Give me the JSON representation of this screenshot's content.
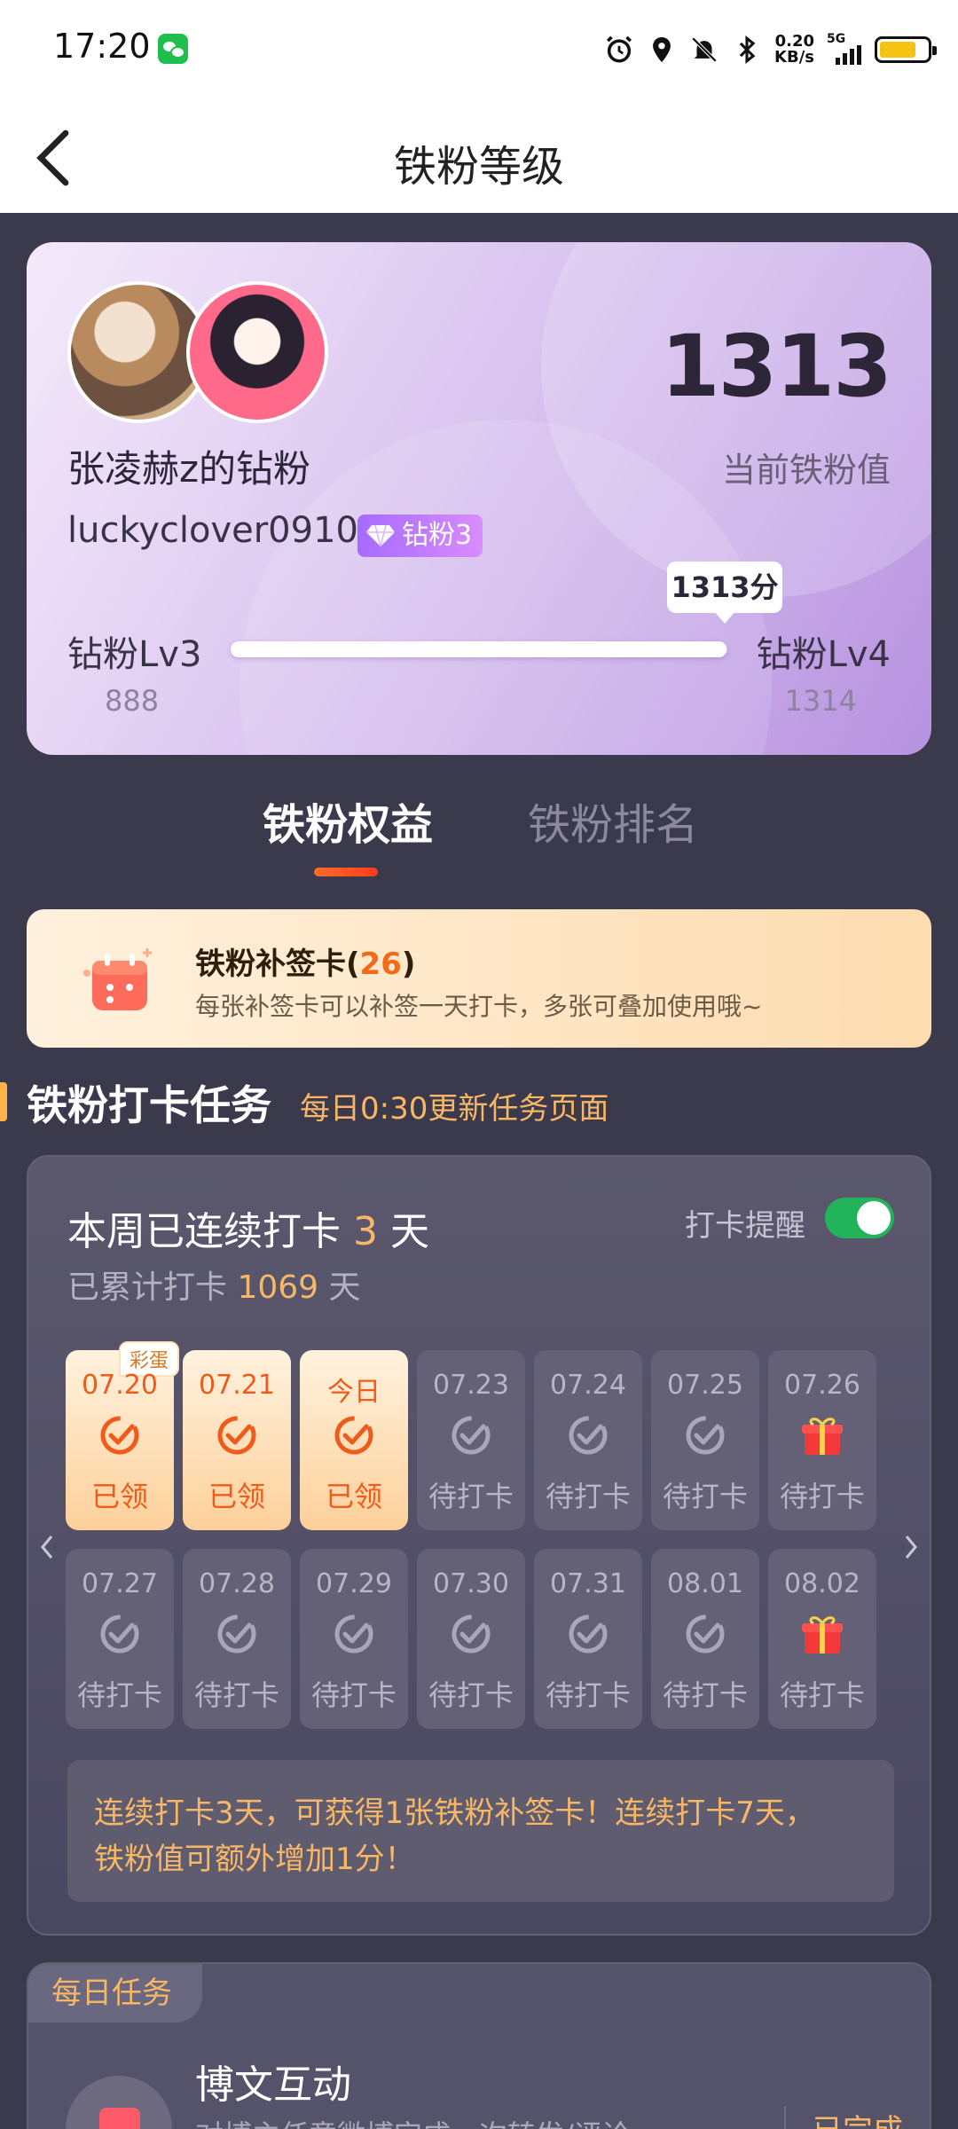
{
  "status_bar": {
    "time": "17:20",
    "net_speed": "0.20",
    "net_unit": "KB/s",
    "signal_label": "5G"
  },
  "nav": {
    "title": "铁粉等级"
  },
  "profile": {
    "fan_name": "张凌赫z的钻粉",
    "username": "luckyclover0910",
    "badge": "钻粉3",
    "fan_value": "1313",
    "fan_value_label": "当前铁粉值",
    "bubble": "1313分",
    "level_left": "钻粉Lv3",
    "level_right": "钻粉Lv4",
    "min_points": "888",
    "max_points": "1314",
    "progress_fraction": 0.998
  },
  "tabs": [
    {
      "label": "铁粉权益",
      "active": true
    },
    {
      "label": "铁粉排名",
      "active": false
    }
  ],
  "resign_card": {
    "title": "铁粉补签卡(",
    "count": "26",
    "title_end": ")",
    "desc": "每张补签卡可以补签一天打卡，多张可叠加使用哦~"
  },
  "section": {
    "title": "铁粉打卡任务",
    "subtitle": "每日0:30更新任务页面"
  },
  "checkin": {
    "streak_prefix": "本周已连续打卡 ",
    "streak_days": "3",
    "streak_suffix": " 天",
    "total_prefix": "已累计打卡 ",
    "total_days": "1069",
    "total_suffix": " 天",
    "remind_label": "打卡提醒",
    "remind_on": true,
    "egg_label": "彩蛋",
    "days": [
      {
        "date": "07.20",
        "status": "已领",
        "state": "done",
        "icon": "check-circle-icon"
      },
      {
        "date": "07.21",
        "status": "已领",
        "state": "done",
        "icon": "check-circle-icon"
      },
      {
        "date": "今日",
        "status": "已领",
        "state": "done",
        "icon": "check-circle-icon"
      },
      {
        "date": "07.23",
        "status": "待打卡",
        "state": "pending",
        "icon": "check-circle-icon"
      },
      {
        "date": "07.24",
        "status": "待打卡",
        "state": "pending",
        "icon": "check-circle-icon"
      },
      {
        "date": "07.25",
        "status": "待打卡",
        "state": "pending",
        "icon": "check-circle-icon"
      },
      {
        "date": "07.26",
        "status": "待打卡",
        "state": "pending",
        "icon": "gift-icon"
      },
      {
        "date": "07.27",
        "status": "待打卡",
        "state": "pending",
        "icon": "check-circle-icon"
      },
      {
        "date": "07.28",
        "status": "待打卡",
        "state": "pending",
        "icon": "check-circle-icon"
      },
      {
        "date": "07.29",
        "status": "待打卡",
        "state": "pending",
        "icon": "check-circle-icon"
      },
      {
        "date": "07.30",
        "status": "待打卡",
        "state": "pending",
        "icon": "check-circle-icon"
      },
      {
        "date": "07.31",
        "status": "待打卡",
        "state": "pending",
        "icon": "check-circle-icon"
      },
      {
        "date": "08.01",
        "status": "待打卡",
        "state": "pending",
        "icon": "check-circle-icon"
      },
      {
        "date": "08.02",
        "status": "待打卡",
        "state": "pending",
        "icon": "gift-icon"
      }
    ],
    "tip_line1": "连续打卡3天，可获得1张铁粉补签卡！连续打卡7天，",
    "tip_line2": "铁粉值可额外增加1分！"
  },
  "daily": {
    "tag": "每日任务",
    "task_title": "博文互动",
    "task_desc": "对博主任意微博完成一次转发/评论",
    "task_status": "已完成"
  },
  "colors": {
    "accent_orange": "#f36a1a",
    "highlight": "#f7b766",
    "toggle_on": "#22b35b",
    "badge_purple": "#a66bff"
  }
}
